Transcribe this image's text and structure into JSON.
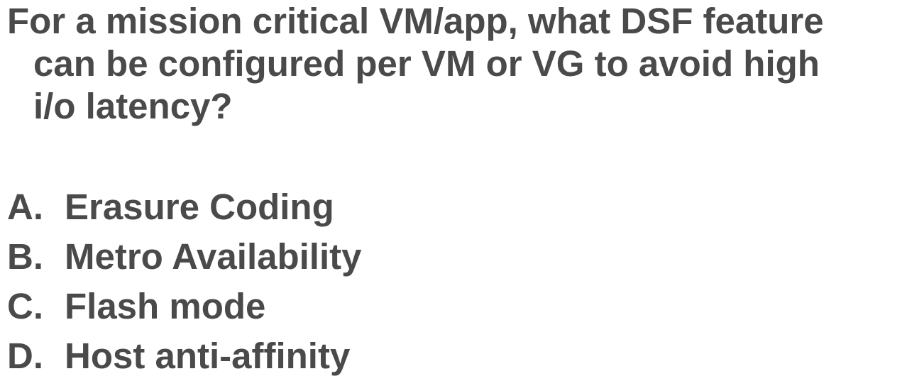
{
  "question": {
    "lines": [
      "For a mission critical VM/app, what DSF feature",
      "can be configured per VM or VG to avoid high",
      "i/o latency?"
    ]
  },
  "options": [
    {
      "letter": "A.",
      "text": "Erasure Coding"
    },
    {
      "letter": "B.",
      "text": "Metro Availability"
    },
    {
      "letter": "C.",
      "text": "Flash mode"
    },
    {
      "letter": "D.",
      "text": "Host anti-affinity"
    }
  ],
  "colors": {
    "text": "#4a4a4a",
    "background": "#ffffff"
  }
}
